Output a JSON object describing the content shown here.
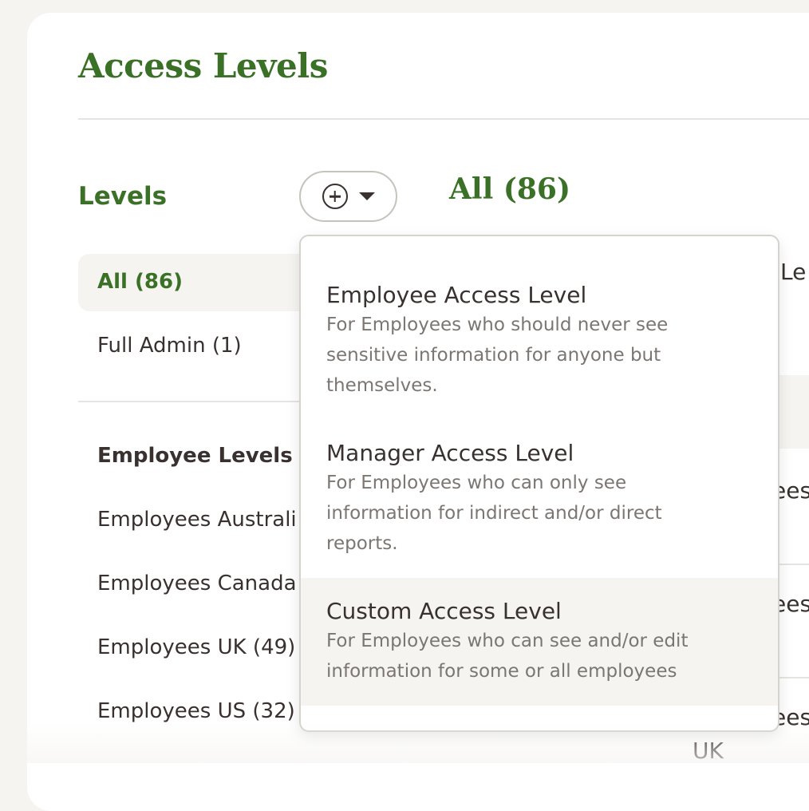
{
  "page": {
    "title": "Access Levels"
  },
  "levels": {
    "heading": "Levels",
    "add_button": {
      "icon": "plus-circle-icon",
      "caret_icon": "caret-down-icon"
    },
    "all_label": "All (86)",
    "full_admin_label": "Full Admin (1)",
    "employee_section": {
      "heading": "Employee Levels",
      "items": [
        {
          "label": "Employees Australi"
        },
        {
          "label": "Employees Canada"
        },
        {
          "label": "Employees UK (49)"
        },
        {
          "label": "Employees US (32)"
        }
      ]
    }
  },
  "main": {
    "heading": "All (86)",
    "fragments": {
      "col": "Le",
      "row1": "ees",
      "row2": "ees",
      "row3": "ees",
      "row3_sub": "UK"
    }
  },
  "dropdown": {
    "options": [
      {
        "title": "Employee Access Level",
        "desc_lines": [
          "For Employees who should never see",
          "sensitive information for anyone but",
          "themselves."
        ]
      },
      {
        "title": "Manager Access Level",
        "desc_lines": [
          "For Employees who can only see",
          "information for indirect and/or direct",
          "reports."
        ]
      },
      {
        "title": "Custom Access Level",
        "desc_lines": [
          "For Employees who can see and/or edit",
          "information for some or all employees"
        ]
      }
    ]
  },
  "colors": {
    "brand_green": "#3a7127",
    "text": "#38312f",
    "muted": "#7b7672",
    "highlight_bg": "#f5f4f1"
  }
}
